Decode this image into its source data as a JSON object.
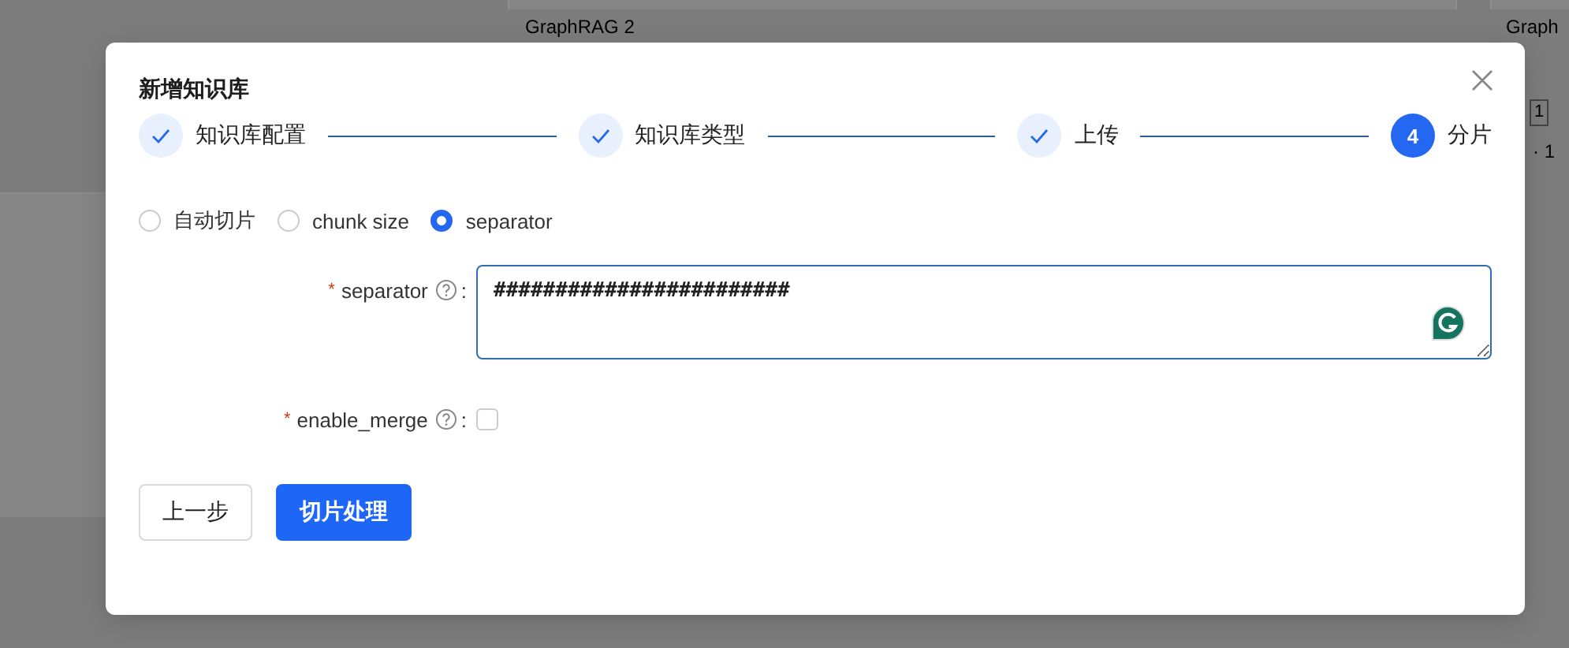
{
  "background": {
    "texts": [
      {
        "label": "GraphRAG 2"
      },
      {
        "label": "Graph"
      },
      {
        "label": "1"
      },
      {
        "label": "· 1"
      }
    ]
  },
  "dialog": {
    "title": "新增知识库",
    "steps": [
      {
        "label": "知识库配置",
        "kind": "done"
      },
      {
        "label": "知识库类型",
        "kind": "done"
      },
      {
        "label": "上传",
        "kind": "done"
      },
      {
        "label": "分片",
        "number": "4",
        "kind": "current"
      }
    ],
    "modes": [
      {
        "label": "自动切片",
        "selected": false
      },
      {
        "label": "chunk size",
        "selected": false
      },
      {
        "label": "separator",
        "selected": true
      }
    ],
    "fields": [
      {
        "kind": "textarea",
        "required_mark": "*",
        "label": "separator",
        "colon": ":",
        "value": "########################"
      },
      {
        "kind": "checkbox",
        "required_mark": "*",
        "label": "enable_merge",
        "colon": ":",
        "checked": false
      }
    ],
    "buttons": [
      {
        "label": "上一步",
        "kind": "default"
      },
      {
        "label": "切片处理",
        "kind": "primary"
      }
    ]
  }
}
